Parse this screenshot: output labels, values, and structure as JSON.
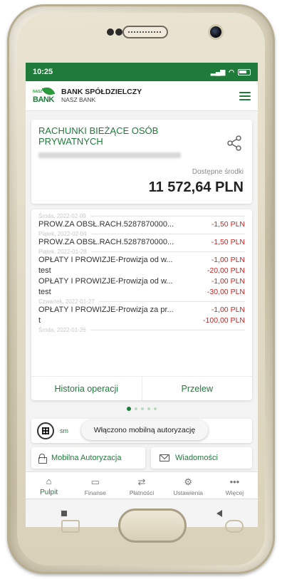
{
  "status": {
    "time": "10:25"
  },
  "header": {
    "bank_name": "BANK SPÓŁDZIELCZY",
    "bank_sub": "NASZ BANK",
    "logo_small": "NASZ",
    "logo_big": "BANK"
  },
  "account": {
    "title": "RACHUNKI BIEŻĄCE OSÓB PRYWATNYCH",
    "available_label": "Dostępne środki",
    "balance": "11 572,64 PLN"
  },
  "history": {
    "dates": [
      "Środa, 2022-02-09",
      "Piątek, 2022-02-04",
      "Piątek, 2022-01-28",
      "Czwartek, 2022-01-27",
      "Środa, 2022-01-26"
    ],
    "transactions": [
      {
        "desc": "PROW.ZA OBSŁ.RACH.5287870000...",
        "amount": "-1,50 PLN"
      },
      {
        "desc": "PROW.ZA OBSŁ.RACH.5287870000...",
        "amount": "-1,50 PLN"
      },
      {
        "desc": "OPŁATY I PROWIZJE-Prowizja od w...",
        "amount": "-1,00 PLN"
      },
      {
        "desc": "test",
        "amount": "-20,00 PLN"
      },
      {
        "desc": "OPŁATY I PROWIZJE-Prowizja od w...",
        "amount": "-1,00 PLN"
      },
      {
        "desc": "test",
        "amount": "-30,00 PLN"
      },
      {
        "desc": "OPŁATY I PROWIZJE-Prowizja za pr...",
        "amount": "-1,00 PLN"
      },
      {
        "desc": "t",
        "amount": "-100,00 PLN"
      }
    ],
    "history_button": "Historia operacji",
    "transfer_button": "Przelew"
  },
  "qr": {
    "label": "sm"
  },
  "toast": "Włączono mobilną autoryzację",
  "shortcuts": {
    "mobile_auth": "Mobilna Autoryzacja",
    "messages": "Wiadomości"
  },
  "nav": [
    {
      "label": "Pulpit",
      "icon": "home-icon"
    },
    {
      "label": "Finanse",
      "icon": "wallet-icon"
    },
    {
      "label": "Płatności",
      "icon": "transfer-icon"
    },
    {
      "label": "Ustawienia",
      "icon": "gear-icon"
    },
    {
      "label": "Więcej",
      "icon": "more-icon"
    }
  ],
  "colors": {
    "accent": "#1f7b3a",
    "negative": "#d42020"
  }
}
